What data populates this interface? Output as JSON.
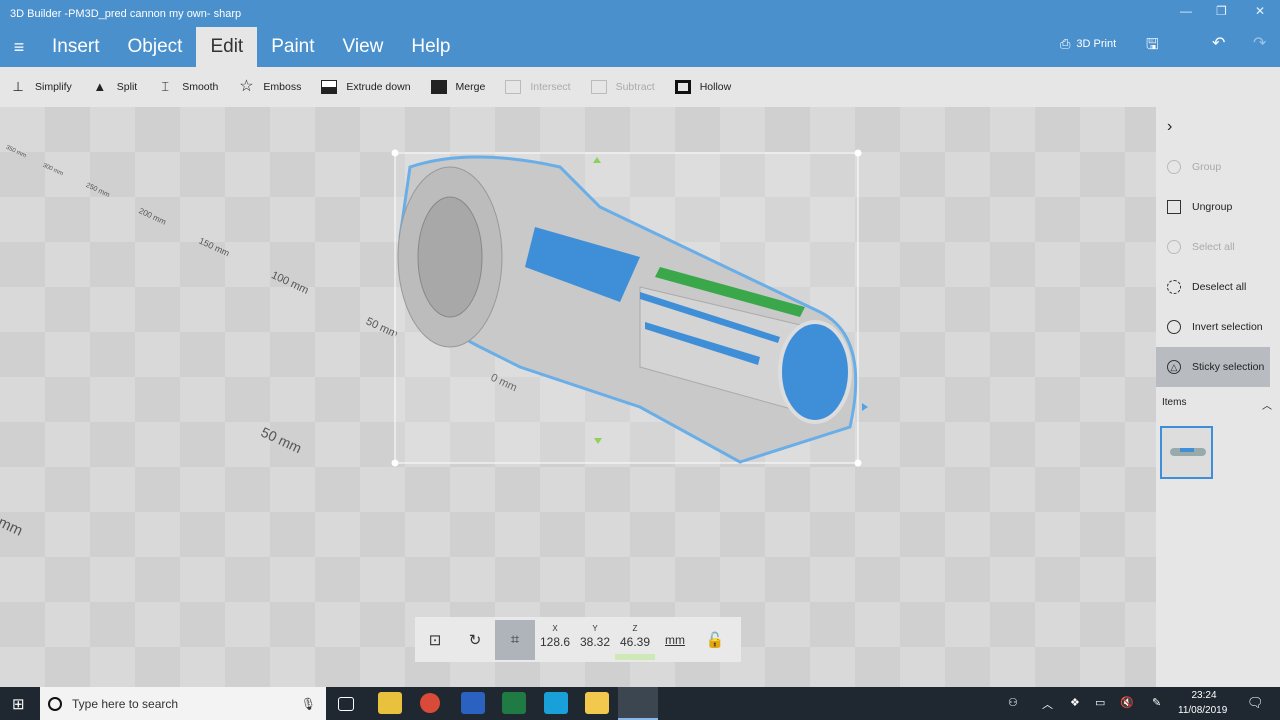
{
  "window": {
    "title": "3D Builder -PM3D_pred cannon my own- sharp",
    "minimize": "—",
    "maximize": "❐",
    "close": "✕"
  },
  "menu": {
    "tabs": [
      {
        "label": "Insert"
      },
      {
        "label": "Object"
      },
      {
        "label": "Edit",
        "active": true
      },
      {
        "label": "Paint"
      },
      {
        "label": "View"
      },
      {
        "label": "Help"
      }
    ],
    "print_label": "3D Print"
  },
  "ribbon": [
    {
      "label": "Simplify",
      "icon": "simplify-icon",
      "enabled": true
    },
    {
      "label": "Split",
      "icon": "split-icon",
      "enabled": true
    },
    {
      "label": "Smooth",
      "icon": "smooth-icon",
      "enabled": true
    },
    {
      "label": "Emboss",
      "icon": "star-icon",
      "enabled": true
    },
    {
      "label": "Extrude down",
      "icon": "extrude-down-icon",
      "enabled": true
    },
    {
      "label": "Merge",
      "icon": "merge-icon",
      "enabled": true
    },
    {
      "label": "Intersect",
      "icon": "intersect-icon",
      "enabled": false
    },
    {
      "label": "Subtract",
      "icon": "subtract-icon",
      "enabled": false
    },
    {
      "label": "Hollow",
      "icon": "hollow-icon",
      "enabled": true
    }
  ],
  "floor_labels": [
    "50 mm",
    "0 mm",
    "50 mm",
    "100 mm",
    "150 mm",
    "200 mm",
    "250 mm",
    "300 mm",
    "350 mm",
    "100 mm"
  ],
  "side": {
    "items": [
      {
        "label": "Group",
        "enabled": false
      },
      {
        "label": "Ungroup",
        "enabled": true
      },
      {
        "label": "Select all",
        "enabled": false
      },
      {
        "label": "Deselect all",
        "enabled": true
      },
      {
        "label": "Invert selection",
        "enabled": true
      },
      {
        "label": "Sticky selection",
        "enabled": true,
        "selected": true
      }
    ],
    "items_header": "Items"
  },
  "dimensions": {
    "x_label": "X",
    "y_label": "Y",
    "z_label": "Z",
    "x": "128.6",
    "y": "38.32",
    "z": "46.39",
    "unit": "mm"
  },
  "taskbar": {
    "search_placeholder": "Type here to search",
    "time": "23:24",
    "date": "11/08/2019"
  },
  "colors": {
    "accent": "#4a90cd",
    "selection": "#6aaee8",
    "model_blue": "#3f8fd8",
    "model_green": "#3aa84a"
  }
}
